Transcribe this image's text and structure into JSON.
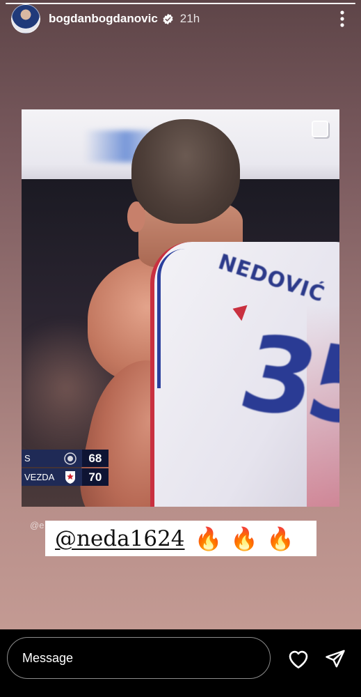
{
  "header": {
    "username": "bogdanbogdanovic",
    "verified_icon": "verified-badge-icon",
    "time_ago": "21h",
    "more_icon": "more-vertical-icon"
  },
  "progress": {
    "fraction": 1.0
  },
  "media": {
    "scoreboard": {
      "teams": [
        {
          "name": "S",
          "score": "68"
        },
        {
          "name": "VEZDA",
          "score": "70"
        }
      ]
    },
    "jersey_number": "35",
    "jersey_name": "NEDOVIĆ"
  },
  "sticker": {
    "watermark": "@e",
    "mention": "@neda1624",
    "emojis": "🔥🔥🔥"
  },
  "footer": {
    "message_placeholder": "Message",
    "like_icon": "heart-icon",
    "send_icon": "send-icon"
  },
  "colors": {
    "background_top": "#5e4548",
    "background_bottom": "#c39a93",
    "scoreboard_bg": "#1f2a56",
    "jersey_blue": "#2a3b94",
    "jersey_red": "#c93040"
  }
}
